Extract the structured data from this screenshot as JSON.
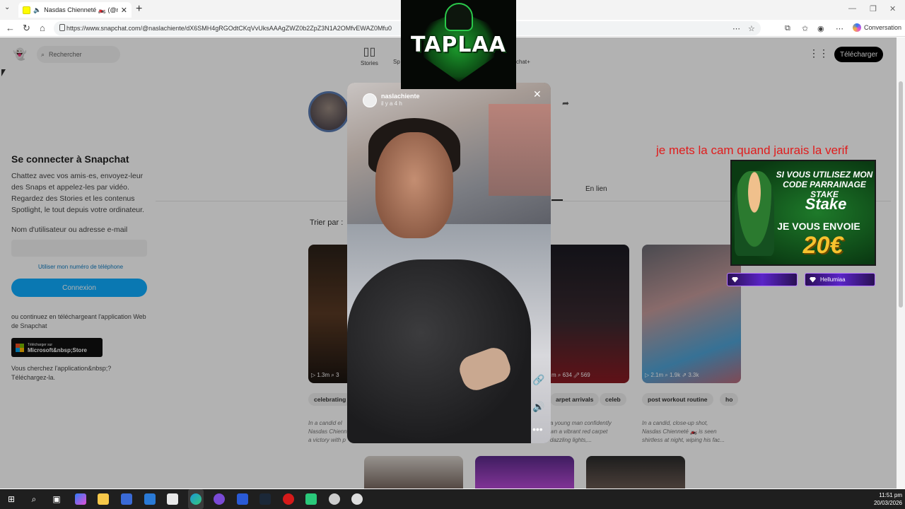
{
  "browser": {
    "tab_title": "Nasdas Chienneté 🏍️ (@nasla",
    "tab_close": "✕",
    "new_tab": "+",
    "url": "https://www.snapchat.com/@naslachiente/dX6SMH4gRGOdtCKqVvUksAAAgZWZ0b2ZpZ3N1A2OMfvEWAZ0Mfu0",
    "conversation_label": "Conversation"
  },
  "snapchat": {
    "search_placeholder": "Rechercher",
    "nav": [
      {
        "label": "Stories",
        "icon": "stories-icon"
      },
      {
        "label": "Sp",
        "icon": "spotlight-icon"
      },
      {
        "label": "chat+",
        "icon": "snapchat-plus-icon"
      }
    ],
    "download_button": "Télécharger",
    "tab_link": "En lien",
    "sort_label": "Trier par :",
    "login": {
      "title": "Se connecter à Snapchat",
      "description": "Chattez avec vos amis·es, envoyez-leur des Snaps et appelez-les par vidéo. Regardez des Stories et les contenus Spotlight, le tout depuis votre ordinateur.",
      "username_label": "Nom d'utilisateur ou adresse e-mail",
      "phone_link": "Utiliser mon numéro de téléphone",
      "login_button": "Connexion",
      "or_text": "ou continuez en téléchargeant l'application Web de Snapchat",
      "ms_small": "Télécharger sur",
      "ms_big": "Microsoft&nbsp;Store",
      "looking_text": "Vous cherchez l'application&nbsp;?",
      "download_link": "Téléchargez-la."
    },
    "cards": [
      {
        "stats": "▷ 1.3m  ⌕ 3",
        "tag": "celebrating",
        "desc": [
          "In a candid el",
          "Nasdas Chienn",
          "a victory with p"
        ]
      },
      {
        "stats": "",
        "tag": "",
        "desc": [
          "",
          "",
          ""
        ]
      },
      {
        "stats": "m  ⌕ 634  ⇗ 569",
        "tag": "arpet arrivals",
        "tag2": "celeb",
        "desc": [
          "a young man confidently",
          "wn a vibrant red carpet",
          "dazzling lights,..."
        ]
      },
      {
        "stats": "▷ 2.1m  ⌕ 1.9k  ⇗ 3.3k",
        "tag": "post workout routine",
        "tag2": "ho",
        "desc": [
          "In a candid, close-up shot,",
          "Nasdas Chienneté 🏍️ is seen",
          "shirtless at night, wiping his fac..."
        ]
      }
    ],
    "story": {
      "username": "naslachiente",
      "time": "il y a 4 h",
      "close": "✕"
    }
  },
  "stream": {
    "logo_text": "TAPLAA",
    "cam_message": "je mets la cam quand jaurais la verif",
    "stake_line1": "SI VOUS UTILISEZ MON CODE PARRAINAGE STAKE",
    "stake_logo": "Stake",
    "stake_line2": "JE VOUS ENVOIE",
    "stake_amount": "20€",
    "sub_names": [
      "",
      "Hellumiaa"
    ]
  },
  "taskbar": {
    "time": "11:51 pm",
    "date": "20/03/2026"
  }
}
